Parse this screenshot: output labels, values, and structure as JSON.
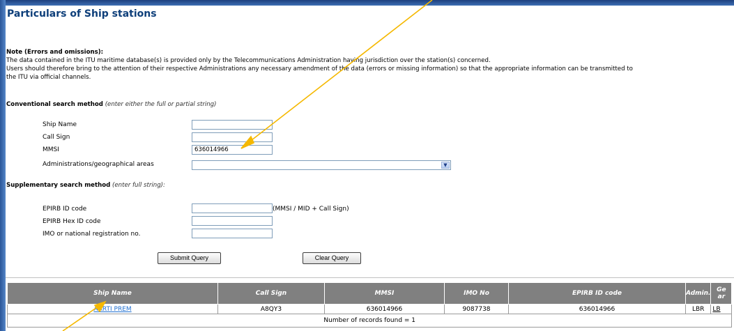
{
  "page_title": "Particulars of Ship stations",
  "note": {
    "heading": "Note (Errors and omissions):",
    "line1": "The data contained in the ITU maritime database(s) is provided only by the Telecommunications Administration having jurisdiction over the station(s) concerned.",
    "line2": "Users should therefore bring to the attention of their respective Administrations any necessary amendment of the data (errors or missing information) so that the appropriate information can be transmitted to",
    "line3": "the ITU via official channels."
  },
  "conventional": {
    "heading": "Conventional search method",
    "hint": "(enter either the full or partial string)",
    "ship_name_label": "Ship Name",
    "ship_name_value": "",
    "call_sign_label": "Call Sign",
    "call_sign_value": "",
    "mmsi_label": "MMSI",
    "mmsi_value": "636014966",
    "admin_label": "Administrations/geographical areas",
    "admin_value": ""
  },
  "supplementary": {
    "heading": "Supplementary search method",
    "hint": "(enter full string):",
    "epirb_id_label": "EPIRB ID code",
    "epirb_id_value": "",
    "epirb_id_hint": "(MMSI / MID + Call Sign)",
    "epirb_hex_label": "EPIRB Hex ID code",
    "epirb_hex_value": "",
    "imo_label": "IMO or national registration no.",
    "imo_value": ""
  },
  "buttons": {
    "submit": "Submit Query",
    "clear": "Clear Query"
  },
  "results": {
    "columns": [
      "Ship Name",
      "Call Sign",
      "MMSI",
      "IMO No",
      "EPIRB ID code",
      "Admin.",
      "Ge",
      "ar"
    ],
    "rows": [
      {
        "ship_name": "AARTI PREM",
        "call_sign": "A8QY3",
        "mmsi": "636014966",
        "imo": "9087738",
        "epirb": "636014966",
        "admin": "LBR",
        "geo": "LB"
      }
    ],
    "count_text": "Number of records found = 1"
  },
  "colors": {
    "title": "#0e3f7a",
    "header_bg": "#808080",
    "link": "#1f6fd1",
    "annotation_arrow": "#f5b800"
  }
}
